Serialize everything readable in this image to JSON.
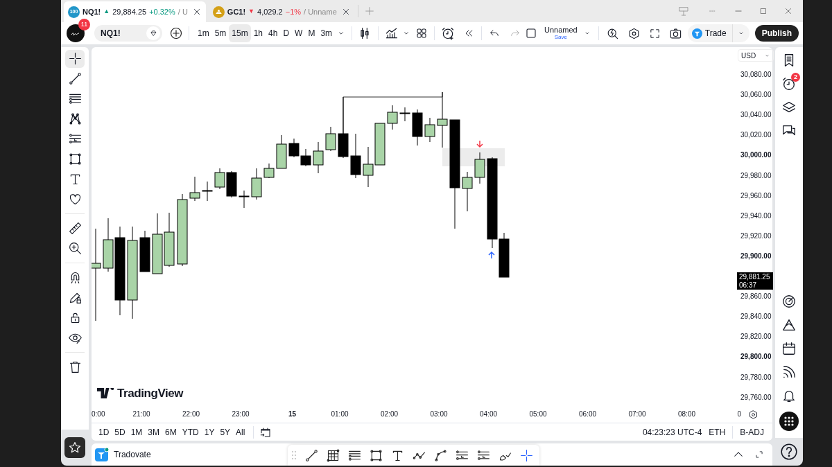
{
  "tabs": [
    {
      "logo_text": "100",
      "symbol": "NQ1!",
      "arrow": "▲",
      "price": "29,884.25",
      "change": "+0.32%",
      "color": "#089981",
      "layout": "/ U",
      "selected": true
    },
    {
      "symbol": "GC1!",
      "arrow": "▼",
      "price": "4,029.2",
      "change": "−1%",
      "color": "#f23645",
      "layout": "/ Unname",
      "selected": false
    }
  ],
  "toolbar": {
    "avatar_badge": "11",
    "symbol": "NQ1!",
    "intervals": [
      {
        "label": "1m",
        "selected": false
      },
      {
        "label": "5m",
        "selected": false
      },
      {
        "label": "15m",
        "selected": true
      },
      {
        "label": "1h",
        "selected": false
      },
      {
        "label": "4h",
        "selected": false
      },
      {
        "label": "D",
        "selected": false
      },
      {
        "label": "W",
        "selected": false
      },
      {
        "label": "M",
        "selected": false
      },
      {
        "label": "3m",
        "selected": false
      }
    ],
    "layout_name": "Unnamed",
    "layout_action": "Save",
    "trade": "Trade",
    "publish": "Publish"
  },
  "left_toolbar": {
    "groups": [
      {
        "tools": [
          {
            "kind": "crosshair",
            "selected": true
          },
          {
            "kind": "trendline",
            "selected": false
          },
          {
            "kind": "fib",
            "selected": false
          },
          {
            "kind": "pattern",
            "selected": false
          },
          {
            "kind": "position",
            "selected": false
          },
          {
            "kind": "rectangle",
            "selected": false
          },
          {
            "kind": "text",
            "selected": false
          },
          {
            "kind": "heart",
            "selected": false
          }
        ]
      },
      {
        "tools": [
          {
            "kind": "ruler",
            "selected": false
          },
          {
            "kind": "zoom",
            "selected": false
          }
        ]
      },
      {
        "tools": [
          {
            "kind": "magnet",
            "selected": false
          },
          {
            "kind": "pencil_lock",
            "selected": false
          },
          {
            "kind": "lock",
            "selected": false
          },
          {
            "kind": "eye",
            "selected": false
          }
        ]
      },
      {
        "tools": [
          {
            "kind": "trash",
            "selected": false
          }
        ]
      }
    ]
  },
  "chart": {
    "currency": "USD",
    "watermark": "TradingView",
    "price_scale": [
      {
        "kind": "tick",
        "label": "30,080.00",
        "major": false
      },
      {
        "kind": "tick",
        "label": "30,060.00",
        "major": false
      },
      {
        "kind": "tick",
        "label": "30,040.00",
        "major": false
      },
      {
        "kind": "tick",
        "label": "30,020.00",
        "major": false
      },
      {
        "kind": "tick",
        "label": "30,000.00",
        "major": true
      },
      {
        "kind": "tick",
        "label": "29,980.00",
        "major": false
      },
      {
        "kind": "tick",
        "label": "29,960.00",
        "major": false
      },
      {
        "kind": "tick",
        "label": "29,940.00",
        "major": false
      },
      {
        "kind": "tick",
        "label": "29,920.00",
        "major": false
      },
      {
        "kind": "tick",
        "label": "29,900.00",
        "major": true
      },
      {
        "kind": "last_price",
        "label": "29,881.25",
        "countdown": "06:37"
      },
      {
        "kind": "tick",
        "label": "29,860.00",
        "major": false
      },
      {
        "kind": "tick",
        "label": "29,840.00",
        "major": false
      },
      {
        "kind": "tick",
        "label": "29,820.00",
        "major": false
      },
      {
        "kind": "tick",
        "label": "29,800.00",
        "major": true
      },
      {
        "kind": "tick",
        "label": "29,780.00",
        "major": false
      },
      {
        "kind": "tick",
        "label": "29,760.00",
        "major": false
      }
    ],
    "time_scale": [
      {
        "label": "0:00",
        "major": false
      },
      {
        "label": "21:00",
        "major": false
      },
      {
        "label": "22:00",
        "major": false
      },
      {
        "label": "23:00",
        "major": false
      },
      {
        "label": "15",
        "major": true
      },
      {
        "label": "01:00",
        "major": false
      },
      {
        "label": "02:00",
        "major": false
      },
      {
        "label": "03:00",
        "major": false
      },
      {
        "label": "04:00",
        "major": false
      },
      {
        "label": "05:00",
        "major": false
      },
      {
        "label": "06:00",
        "major": false
      },
      {
        "label": "07:00",
        "major": false
      },
      {
        "label": "08:00",
        "major": false
      },
      {
        "label": "0",
        "major": false
      }
    ]
  },
  "range_bar": {
    "ranges": [
      "1D",
      "5D",
      "1M",
      "3M",
      "6M",
      "YTD",
      "1Y",
      "5Y",
      "All"
    ],
    "clock": "04:23:23 UTC-4",
    "session": "ETH",
    "adjustment": "B-ADJ"
  },
  "right_toolbar": {
    "alerts_badge": "2"
  },
  "footer": {
    "broker": "Tradovate",
    "drawing_tools": [
      {
        "kind": "trendline",
        "selected": false
      },
      {
        "kind": "grid",
        "selected": false
      },
      {
        "kind": "fib",
        "selected": false
      },
      {
        "kind": "rectangle",
        "selected": false
      },
      {
        "kind": "text",
        "selected": false
      },
      {
        "kind": "path",
        "selected": false
      },
      {
        "kind": "curve",
        "selected": false
      },
      {
        "kind": "position",
        "selected": false
      },
      {
        "kind": "position",
        "selected": false
      },
      {
        "kind": "brush",
        "selected": false
      },
      {
        "kind": "crosshair",
        "selected": true
      }
    ]
  }
}
